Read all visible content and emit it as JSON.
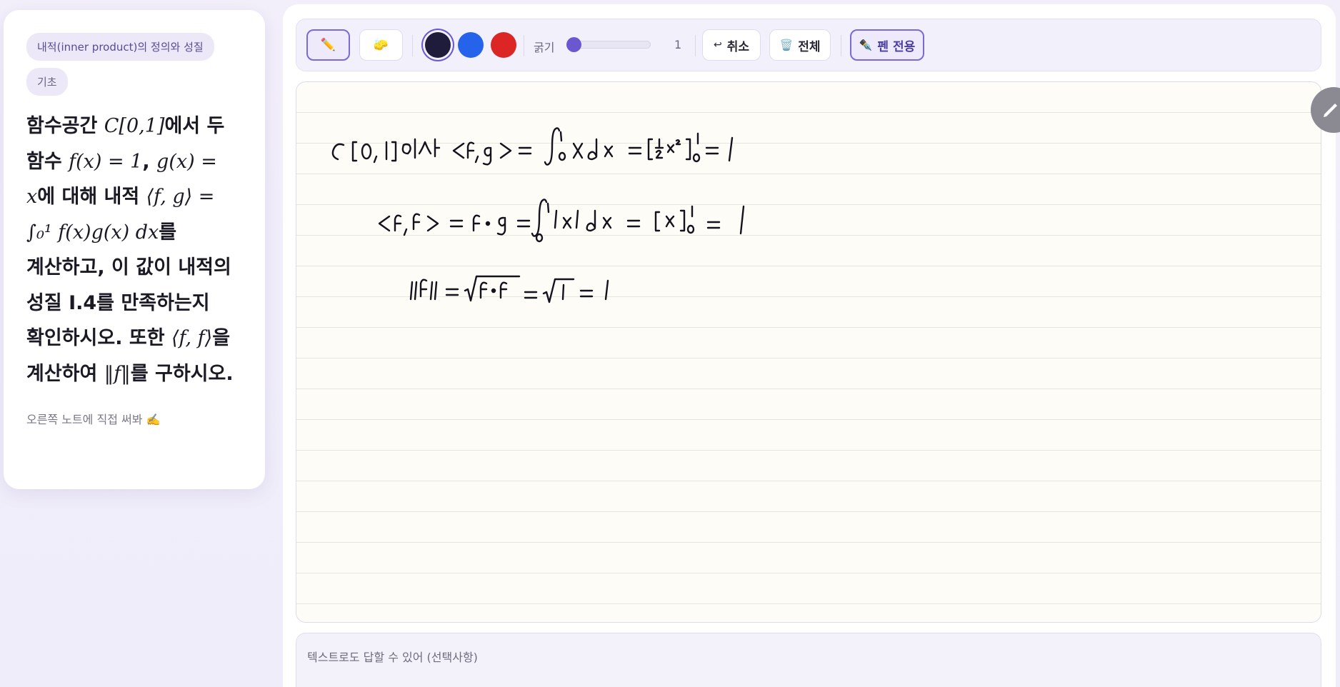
{
  "question": {
    "topic_chip": "내적(inner product)의 정의와 성질",
    "level_chip": "기초",
    "text": {
      "p1": "함수공간 ",
      "m1": "C[0,1]",
      "p2": "에서 두 함수 ",
      "m2": "f(x) = 1",
      "p3": ", ",
      "m3": "g(x) = x",
      "p4": "에 대해 내적 ",
      "m4": "⟨f, g⟩ = ∫₀¹ f(x)g(x) dx",
      "p5": "를 계산하고, 이 값이 내적의 성질 I.4를 만족하는지 확인하시오. 또한 ",
      "m5": "⟨f, f⟩",
      "p6": "을 계산하여 ",
      "m6": "‖f‖",
      "p7": "를 구하시오."
    },
    "hint": "오른쪽 노트에 직접 써봐 ✍️"
  },
  "toolbar": {
    "pen_icon": "✏️",
    "eraser_icon": "🧽",
    "colors": [
      "#1f1b3a",
      "#2563eb",
      "#dc2626"
    ],
    "thickness_label": "굵기",
    "thickness_value": "1",
    "undo_icon": "↩",
    "undo_label": "취소",
    "clear_icon": "🗑️",
    "clear_label": "전체",
    "pen_only_icon": "✒️",
    "pen_only_label": "펜 전용"
  },
  "canvas": {
    "handwritten_lines": [
      "C[0,1]에서 ⟨f,g⟩ = ∫₀¹ x dx = [½x²]₀¹ = 1",
      "⟨f,f⟩ = f·g = ∫₀¹ 1×1 dx = [x]₀¹ = 1",
      "‖f‖ = √(f·f) = √1 = 1"
    ],
    "ink_color": "#14121c"
  },
  "text_answer": {
    "placeholder": "텍스트로도 답할 수 있어 (선택사항)"
  },
  "accent": "#6b58d0"
}
